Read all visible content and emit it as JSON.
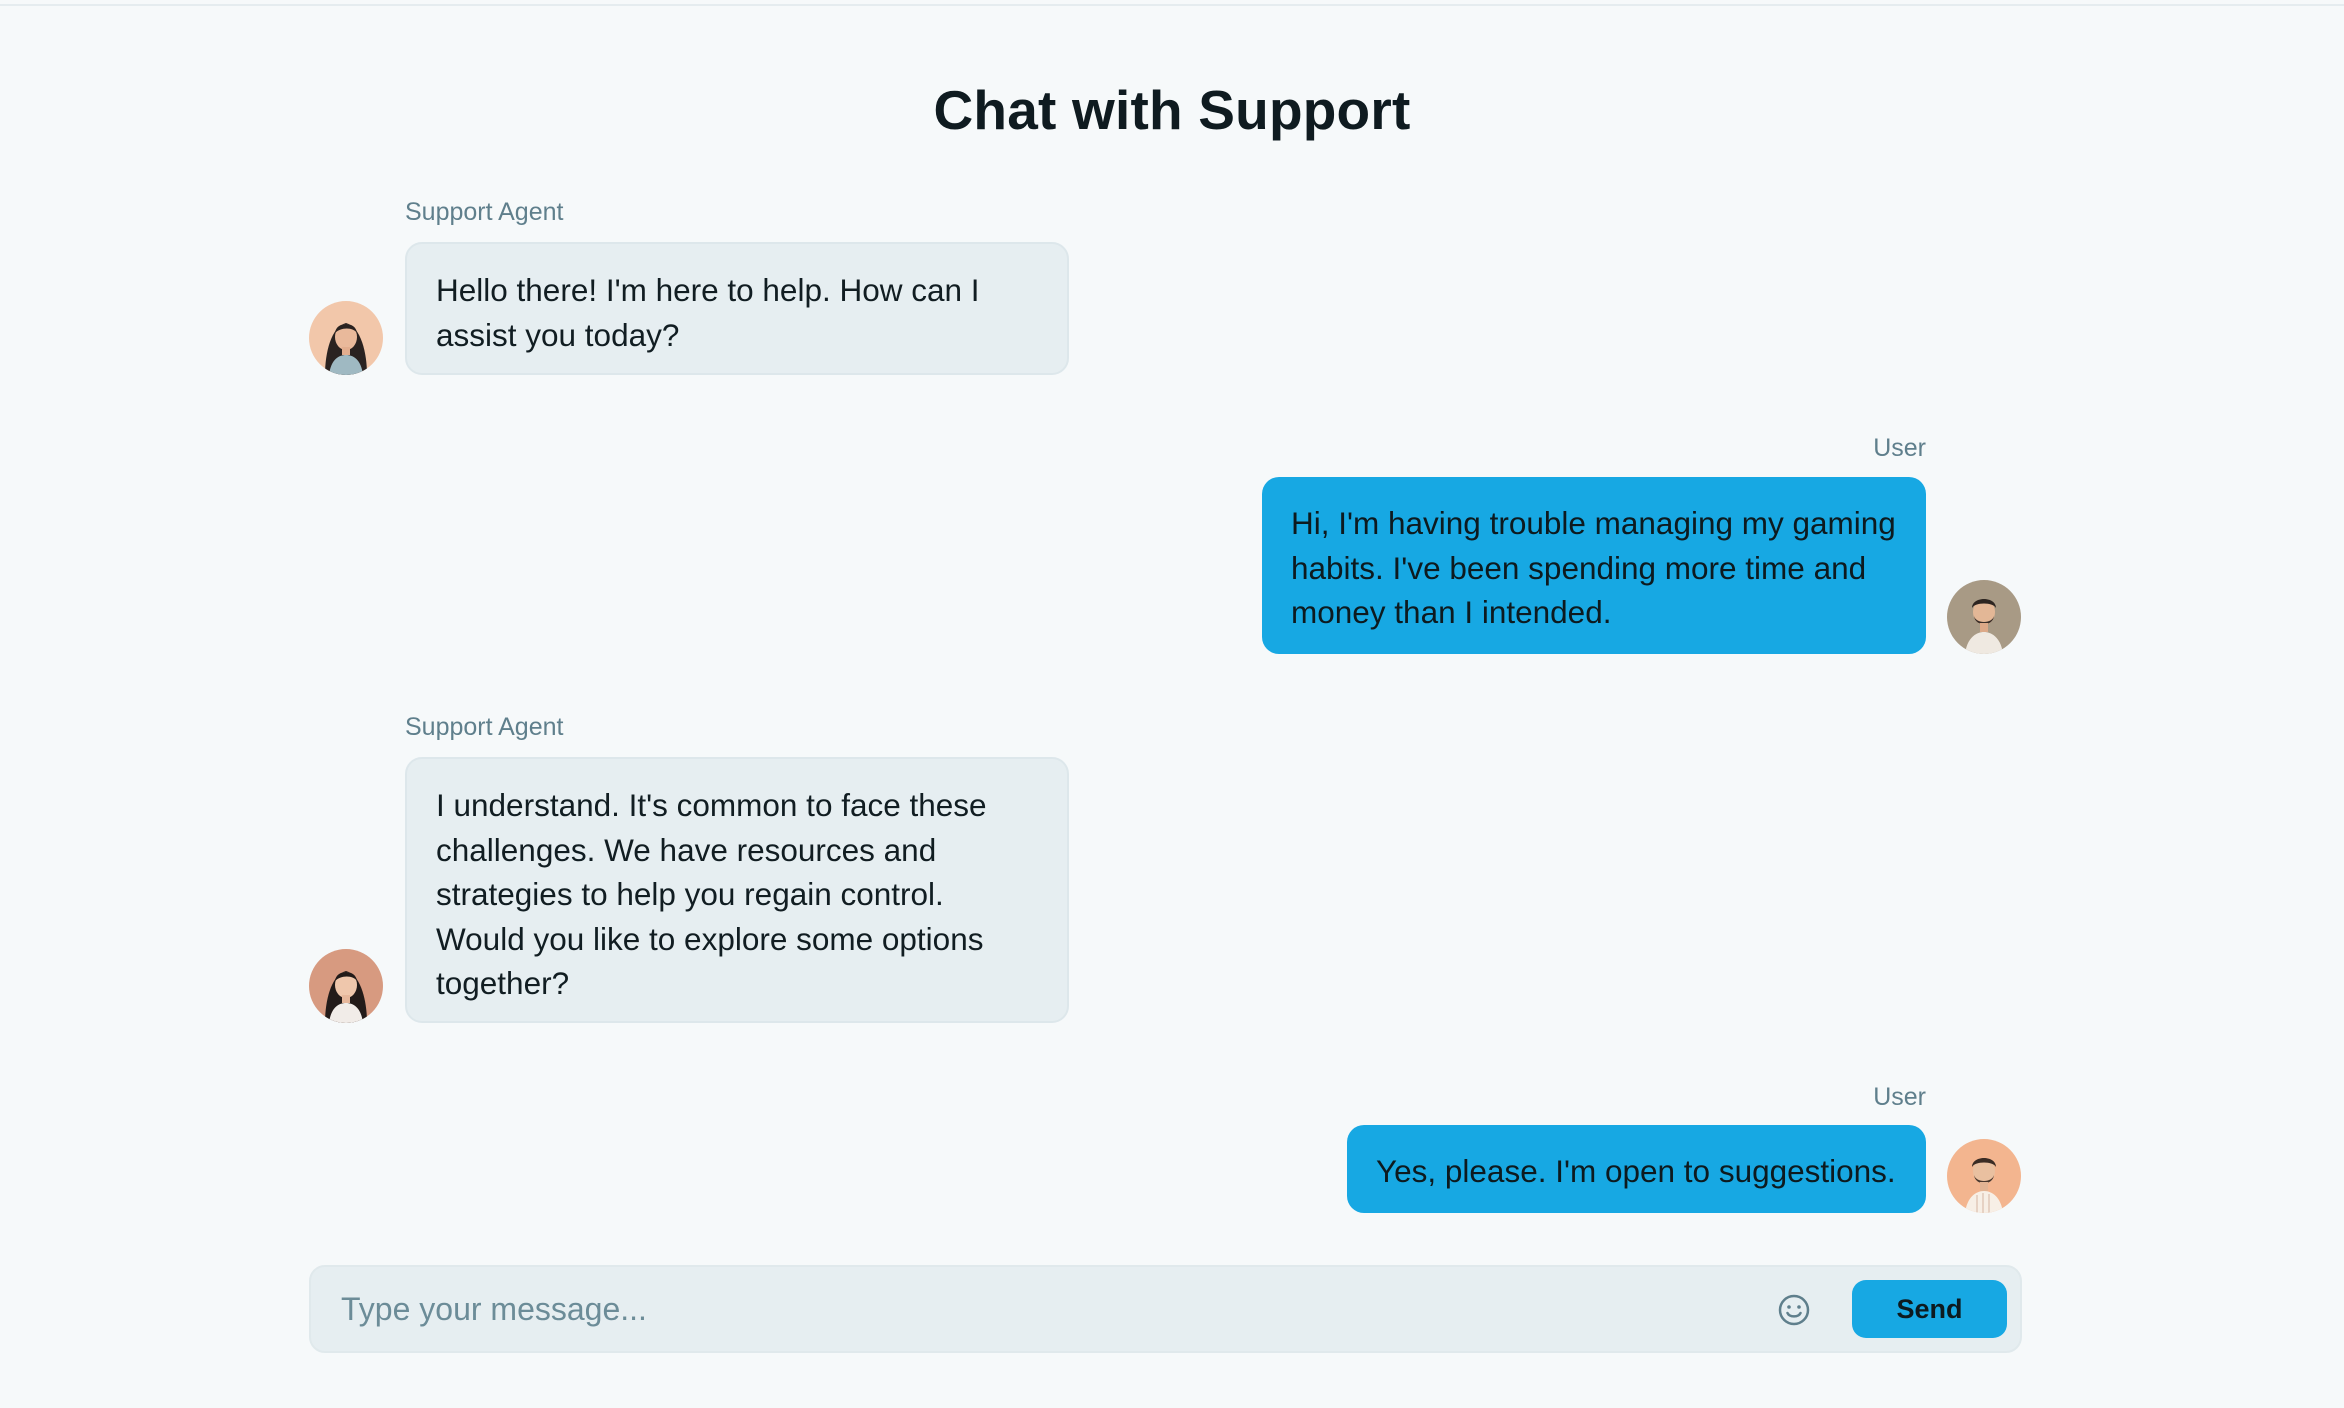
{
  "page": {
    "title": "Chat with Support"
  },
  "messages": [
    {
      "sender": "Support Agent",
      "role": "agent",
      "text": "Hello there! I'm here to help. How can I assist you today?"
    },
    {
      "sender": "User",
      "role": "user",
      "text": "Hi, I'm having trouble managing my gaming habits. I've been spending more time and money than I intended."
    },
    {
      "sender": "Support Agent",
      "role": "agent",
      "text": "I understand. It's common to face these challenges. We have resources and strategies to help you regain control. Would you like to explore some options together?"
    },
    {
      "sender": "User",
      "role": "user",
      "text": "Yes, please. I'm open to suggestions."
    }
  ],
  "composer": {
    "placeholder": "Type your message...",
    "value": "",
    "emoji_icon": "smiley-face-icon",
    "send_label": "Send"
  },
  "colors": {
    "accent": "#17a8e3",
    "agent_bubble": "#e6eef1",
    "background": "#f6f9fa",
    "label_text": "#5f7f8c"
  }
}
